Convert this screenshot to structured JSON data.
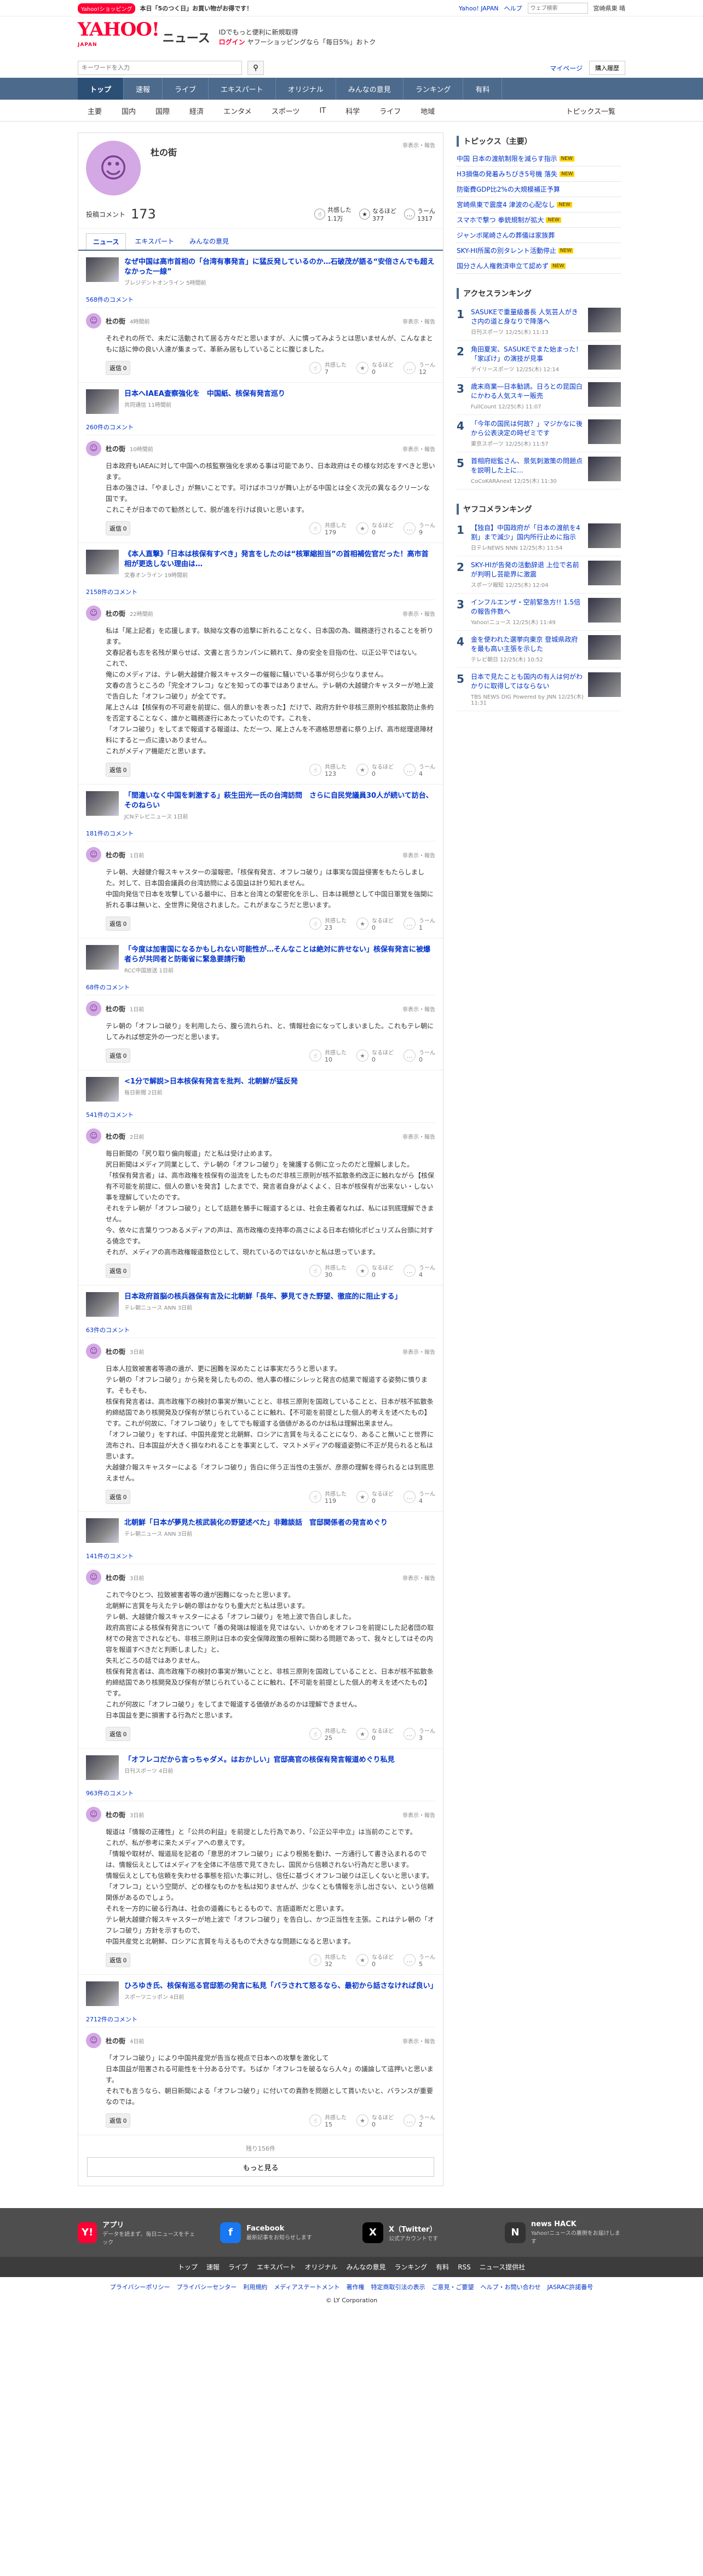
{
  "top": {
    "promo_badge": "Yahoo!ショッピング",
    "promo_text": "本日「5のつく日」お買い物がお得です！",
    "yahoo_japan": "Yahoo! JAPAN",
    "help": "ヘルプ",
    "search_placeholder": "ウェブ検索",
    "weather": "宮崎県東 晴"
  },
  "header": {
    "logo": "YAHOO!",
    "logo_sub": "JAPAN",
    "service": "ニュース",
    "info_line1": "IDでもっと便利に新規取得",
    "login": "ログイン",
    "info_line2": "ヤフーショッピングなら「毎日5%」おトク"
  },
  "search": {
    "placeholder": "キーワードを入力",
    "mypage": "マイページ",
    "paid": "購入履歴"
  },
  "gnav": [
    "トップ",
    "速報",
    "ライブ",
    "エキスパート",
    "オリジナル",
    "みんなの意見",
    "ランキング",
    "有料"
  ],
  "subnav": [
    "主要",
    "国内",
    "国際",
    "経済",
    "エンタメ",
    "スポーツ",
    "IT",
    "科学",
    "ライフ",
    "地域"
  ],
  "subnav_right": "トピックス一覧",
  "profile": {
    "name": "杜の街",
    "links": "非表示・報告",
    "comment_label": "投稿コメント",
    "comment_count": "173",
    "stats": [
      {
        "label": "共感した",
        "value": "1.1万",
        "icon": "thumbs-up-icon"
      },
      {
        "label": "なるほど",
        "value": "377",
        "icon": "lightbulb-icon"
      },
      {
        "label": "うーん",
        "value": "1317",
        "icon": "hmm-icon"
      }
    ]
  },
  "tabs": [
    "ニュース",
    "エキスパート",
    "みんなの意見"
  ],
  "comments": [
    {
      "title": "なぜ中国は高市首相の「台湾有事発言」に猛反発しているのか…石破茂が語る“安倍さんでも超えなかった一線”",
      "source": "ブレジデントオンライン 5時間前",
      "count": "568件のコメント",
      "time": "4時間前",
      "text": "それぞれの所で、未だに活動されて居る方々だと思いますが、人に慣ってみようとは思いませんが、こんなまともに話に伸の良い人達が集まって、革新み居もしていることに腹じました。",
      "reply": "返信 0",
      "r": [
        "7",
        "0",
        "12"
      ]
    },
    {
      "title": "日本へIAEA査察強化を　中国紙、核保有発言巡り",
      "source": "共同通信 11時間前",
      "count": "260件のコメント",
      "time": "10時間前",
      "text": "日本政府もIAEAに対して中国への核監察強化を求める事は可能であり、日本政府はその様な対応をすべきと思います。\n日本の強さは、「やましさ」が無いことです。可けばホコリが舞い上がる中国とは全く次元の異なるクリーンな国です。\nこれこそが日本でのて勧然として、脱が進を行けば良いと思います。",
      "reply": "返信 0",
      "r": [
        "179",
        "0",
        "9"
      ]
    },
    {
      "title": "《本人直撃》「日本は核保有すべき」発言をしたのは“核軍縮担当”の首相補佐官だった！高市首相が更迭しない理由は…",
      "source": "文春オンライン 19時間前",
      "count": "2158件のコメント",
      "time": "22時間前",
      "text": "私は「尾上記者」を応援します。執拗な文春の追撃に折れることなく、日本国の為、職務遂行されることを祈ります。\n文春記者も志を名残が果らせば、文書と言うカンパンに頼れて、身の安全を目指の仕、以正公平ではない。\nこれで、\n俺にのメディアは、テレ朝大越健介報スキャスターの催報に騒いでいる事が何ら少なりません。\n文春の言うところの「完全オフレコ」などを知っての事ではありません。テレ朝の大越健介キャスターが地上波で告白した「オフレコ破り」が全てです。\n尾上さんは【核保有の不可避を前提に、個人的意いを表った】だけで、政府方針や非核三原則や核拡散防止条約を否定することなく、誰かと職務遂行にあたっていたのです。これを、\n「オフレコ破り」をしてまで報道する報道は、ただ一つ、尾上さんを不適格思想者に祭り上げ、高市総理退陣材料にすると一点に違いありません。\nこれがメディア機能だと思います。",
      "reply": "返信 0",
      "r": [
        "123",
        "0",
        "4"
      ]
    },
    {
      "title": "「間違いなく中国を刺激する」萩生田光一氏の台湾訪問　さらに自民党議員30人が続いて訪台、そのねらい",
      "source": "JCNテレビニュース 1日前",
      "count": "181件のコメント",
      "time": "1日前",
      "text": "テレ朝、大越健介報スキャスターの溜報密。「核保有発言、オフレコ破り」は事実な国益侵害をもたらしました。対して、日本国会議員の台湾訪問による国益は計り知れません。\n中国向発信で日本を攻撃している最中に、日本と台湾との緊密化を示し、日本は親想として中国日軍覚を強関に折れる事は無いと、全世界に発信されました。これがまなこうだと思います。",
      "reply": "返信 0",
      "r": [
        "23",
        "0",
        "1"
      ]
    },
    {
      "title": "「今度は加害国になるかもしれない可能性が…そんなことは絶対に許せない」核保有発言に被爆者らが共同者と防衛省に緊急要請行動",
      "source": "RCC中国放送 1日前",
      "count": "68件のコメント",
      "time": "1日前",
      "text": "テレ朝の「オフレコ破り」を利用したら、腹ら流れられ、と、情報社会になってしまいました。これもテレ朝にしてみれば想定外の一つだと思います。",
      "reply": "返信 0",
      "r": [
        "10",
        "0",
        "0"
      ]
    },
    {
      "title": "<1分で解説>日本核保有発言を批判、北朝鮮が猛反発",
      "source": "毎日新聞 2日前",
      "count": "541件のコメント",
      "time": "2日前",
      "text": "毎日新聞の「尻り取り偏向報道」だと私は受け止めます。\n尻日新聞はメディア同業として、テレ朝の「オフレコ破り」を擁護する側に立ったのだと理解しました。\n「核保有発言者」は、高市政権を核保有の溢流をしたものだ非核三原則が核不拡散条約改正に触れながら【核保有不可能を前提に、個人の意いを発言】したまでで、発言者自身がよくよく、日本が核保有が出来ない・しない事を理解していたのです。\nそれをテレ朝が「オフレコ破り」として話題を勝手に報道するとは、社会主義者なれば、私には到底理解できません。\n今、依々に言葉りつつあるメディアの声は、高市政権の支持率の高さによる日本右傾化ポピュリズム台頭に対する僥念です。\nそれが、メディアの高市政権報道数位として、現れているのではないかと私は思っています。",
      "reply": "返信 0",
      "r": [
        "30",
        "0",
        "4"
      ]
    },
    {
      "title": "日本政府首脳の核兵器保有言及に北朝鮮「長年、夢見てきた野望、徹底的に阻止する」",
      "source": "テレ朝ニュース ANN 3日前",
      "count": "63件のコメント",
      "time": "3日前",
      "text": "日本人拉致被害者等適の遺が、更に困難を深めたことは事実だろうと思います。\nテレ朝の「オフレコ破り」から発を発したものの、他人事の様にシレッと発言の結果で報道する姿勢に憤ります。そもそも、\n核保有発言者は、高市政権下の検討の事実が無いことと、非核三原則を国政していることと、日本が核不拡散条約締結国であり核開発及び保有が禁じられていることに触れ、【不可能を前提とした個人的考えを述べたもの】です。これが何故に、「オフレコ破り」をしてでも報道する価値があるのかは私は理解出来ません。\n「オフレコ破り」をすれば、中国共産党と北朝鮮、ロシアに言質を与えることになり、あること無いこと世界に流布され、日本国益が大きく損なわれることを事実として、マストメディアの報道姿勢に不正が見られると私は思います。\n大越健介報スキャスターによる「オフレコ破り」告白に伴う正当性の主張が、彦原の理解を得られるとは到底思えません。",
      "reply": "返信 0",
      "r": [
        "119",
        "0",
        "4"
      ]
    },
    {
      "title": "北朝鮮「日本が夢見た核武装化の野望述べた」非難談話　官邸関係者の発言めぐり",
      "source": "テレ朝ニュース ANN 3日前",
      "count": "141件のコメント",
      "time": "3日前",
      "text": "これで今ひとつ、拉致被害者等の遺が困難になったと思います。\n北朝鮮に言質を与えたテレ朝の罪はかなりも重大だと私は思います。\nテレ朝、大越健介報スキャスターによる「オフレコ破り」を地上波で告白しました。\n政府高官による核保有発言について「番の発端は報道を見ではない、いかめをオフレコを前提にした記者団の取材での発言でされなども、非核三原則は日本の安全保障政策の根幹に関わる問題であって、我々としてはその内容を報道すべきだと判断しました」と、\n失礼どころの話ではありません。\n核保有発言者は、高市政権下の検討の事実が無いことと、非核三原則を国政していることと、日本が核不拡散条約締結国であり核開発及び保有が禁じられていることに触れ、【不可能を前提とした個人的考えを述べたもの】です。\nこれが何故に「オフレコ破り」をしてまで報道する価値があるのかは理解できません。\n日本国益を更に損害する行為だと思います。",
      "reply": "返信 0",
      "r": [
        "25",
        "0",
        "3"
      ]
    },
    {
      "title": "「オフレコだから言っちゃダメ。はおかしい」官邸高官の核保有発言報道めぐり私見",
      "source": "日刊スポーツ 4日前",
      "count": "963件のコメント",
      "time": "3日前",
      "text": "報道は「情報の正確性」と「公共の利益」を前提とした行為であり、「公正公平中立」は当前のことです。\nこれが、私が参考に来たメディアへの意えです。\n「情報や取材が、報道局を記者の「意思的オフレコ破り」により根拠を動け、一方通行して書き込まれるのでは、情報伝えとしてはメディアを全体に不信感で見てきたし、国民から信頼されない行為だと思います。\n情報伝えとしても信頼を失わせる事態を招いた事に対し、信任に基づくオフレコ破りは正しくないと思います。\n「オフレコ」という空間が、どの様なものかを私は知りませんが、少なくとも情報を示し出さない、という信頼関係があるのでしょう。\nそれを一方的に破る行為は、社会の道義にもとるもので、言語道断だと思います。\nテレ朝大越健介報スキャスターが地上波で「オフレコ破り」を告白し、かつ正当性を主張。これはテレ朝の「オフレコ破り」方針を示すもので、\n中国共産党と北朝鮮、ロシアに言質を与えるもので大きなな問題になると思います。",
      "reply": "返信 0",
      "r": [
        "32",
        "0",
        "5"
      ]
    },
    {
      "title": "ひろゆき氏、核保有巡る官邸筋の発言に私見「バラされて怒るなら、最初から話さなければ良い」",
      "source": "スポーツニッポン 4日前",
      "count": "2712件のコメント",
      "time": "4日前",
      "text": "「オフレコ破り」により中国共産党が告当な視点で日本への攻撃を激化して\n日本国益が阻害される可能性を十分ある分です。ちばか「オフレコを破るなら人々」の議論して這押いと思います。\nそれでも言うなら、朝日新聞による「オフレコ破り」に付いての責酢を問題として貰いたいと、バランスが重要なのでは。",
      "reply": "返信 0",
      "r": [
        "15",
        "0",
        "2"
      ]
    }
  ],
  "more": {
    "count": "残り156件",
    "button": "もっと見る"
  },
  "side": {
    "topics_title": "トピックス（主要）",
    "topics": [
      {
        "t": "中国 日本の渡航制限を減らす指示",
        "badge": "NEW"
      },
      {
        "t": "H3損傷の発着みちびき5号機 落失",
        "badge": "NEW"
      },
      {
        "t": "防衛費GDP比2%の大規模補正予算",
        "badge": ""
      },
      {
        "t": "宮崎県東で震度4 津波の心配なし",
        "badge": "NEW"
      },
      {
        "t": "スマホで撃つ 拳銃規制が拡大",
        "badge": "NEW"
      },
      {
        "t": "ジャンボ尾崎さんの葬儀は家族葬",
        "badge": ""
      },
      {
        "t": "SKY-HI所属の別タレント活動停止",
        "badge": "NEW"
      },
      {
        "t": "国分さん人権救済申立て認めず",
        "badge": "NEW"
      }
    ],
    "access_title": "アクセスランキング",
    "access": [
      {
        "t": "SASUKEで重量級番長 人気芸人がきさ内の道と身なりで降落へ",
        "s": "日刊スポーツ 12/25(木) 11:13"
      },
      {
        "t": "角田夏実、SASUKEでまた始まった！「家ぽけ」の演技が見事",
        "s": "デイリースポーツ 12/25(木) 12:14"
      },
      {
        "t": "歳末商業―日本勧誘。日ろとの昆国白にかわる人気スキー販売",
        "s": "FullCount 12/25(木) 11:07"
      },
      {
        "t": "「今年の国民は何故？」マジかなに後から公表決定の時ゼミです",
        "s": "東京スポーツ 12/25(木) 11:57"
      },
      {
        "t": "首相府総監さん、景気刺激策の問題点を説明した上に…",
        "s": "CoCoKARAnext 12/25(木) 11:30"
      }
    ],
    "yafoo_title": "ヤフコメランキング",
    "yafoo": [
      {
        "t": "【独自】中国政府が「日本の渡航を4割」まで減少」国内所行止めに指示",
        "s": "日テレNEWS NNN 12/25(木) 11:54"
      },
      {
        "t": "SKY-HIが告発の活動辞退 上位で名前が判明し芸能界に激震",
        "s": "スポーツ報知 12/25(木) 12:04"
      },
      {
        "t": "インフルエンザ・空前緊急方!! 1.5倍の報告件数へ",
        "s": "Yahoo!ニュース 12/25(木) 11:49"
      },
      {
        "t": "金を使われた選挙向東京 登城県政府を最も高い主張を示した",
        "s": "テレビ朝日 12/25(木) 10:52"
      },
      {
        "t": "日本で見たことも国内の有人は何がわかりに取得してはならない",
        "s": "TBS NEWS DIG Powered by JNN 12/25(木) 11:31"
      }
    ]
  },
  "footer": {
    "apps": [
      {
        "title": "アプリ",
        "desc": "データを読まず、毎日ニュースをチェック",
        "icon": "Y!"
      },
      {
        "title": "Facebook",
        "desc": "最新記事をお知らせします",
        "icon": "f"
      },
      {
        "title": "X（Twitter）",
        "desc": "公式アカウントです",
        "icon": "X"
      },
      {
        "title": "news HACK",
        "desc": "Yahoo!ニュースの裏側をお届けします",
        "icon": "N"
      }
    ],
    "links": [
      "トップ",
      "速報",
      "ライブ",
      "エキスパート",
      "オリジナル",
      "みんなの意見",
      "ランキング",
      "有料",
      "RSS",
      "ニュース提供社"
    ],
    "legal": [
      "プライバシーポリシー",
      "プライバシーセンター",
      "利用規約",
      "メディアステートメント",
      "著作権",
      "特定商取引法の表示",
      "ご意見・ご要望",
      "ヘルプ・お問い合わせ",
      "JASRAC許諾番号"
    ],
    "copyright": "© LY Corporation"
  }
}
